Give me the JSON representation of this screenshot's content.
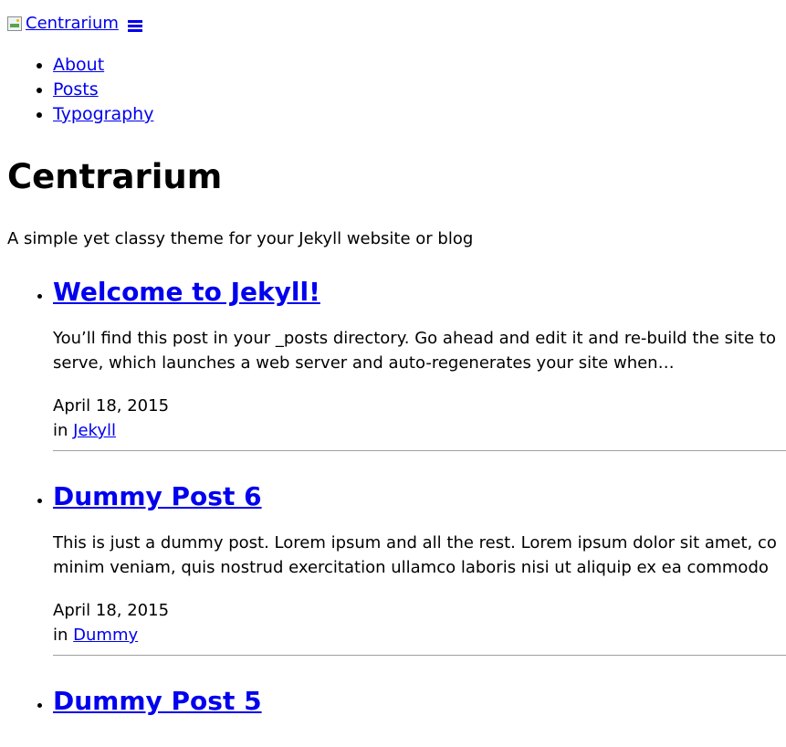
{
  "header": {
    "logo_alt": "Centrarium",
    "menu_icon": "hamburger-icon"
  },
  "nav": {
    "items": [
      {
        "label": "About"
      },
      {
        "label": "Posts"
      },
      {
        "label": "Typography"
      }
    ]
  },
  "site": {
    "title": "Centrarium",
    "tagline": "A simple yet classy theme for your Jekyll website or blog"
  },
  "posts": [
    {
      "title": "Welcome to Jekyll!",
      "excerpt_line1": "You’ll find this post in your _posts directory. Go ahead and edit it and re-build the site to",
      "excerpt_line2": "serve, which launches a web server and auto-regenerates your site when…",
      "date": "April 18, 2015",
      "in_label": "in",
      "category": "Jekyll"
    },
    {
      "title": "Dummy Post 6",
      "excerpt_line1": "This is just a dummy post. Lorem ipsum and all the rest. Lorem ipsum dolor sit amet, co",
      "excerpt_line2": "minim veniam, quis nostrud exercitation ullamco laboris nisi ut aliquip ex ea commodo",
      "date": "April 18, 2015",
      "in_label": "in",
      "category": "Dummy"
    },
    {
      "title": "Dummy Post 5"
    }
  ],
  "colors": {
    "link": "#0000ee",
    "text": "#000000",
    "divider": "#a0a0a0"
  }
}
